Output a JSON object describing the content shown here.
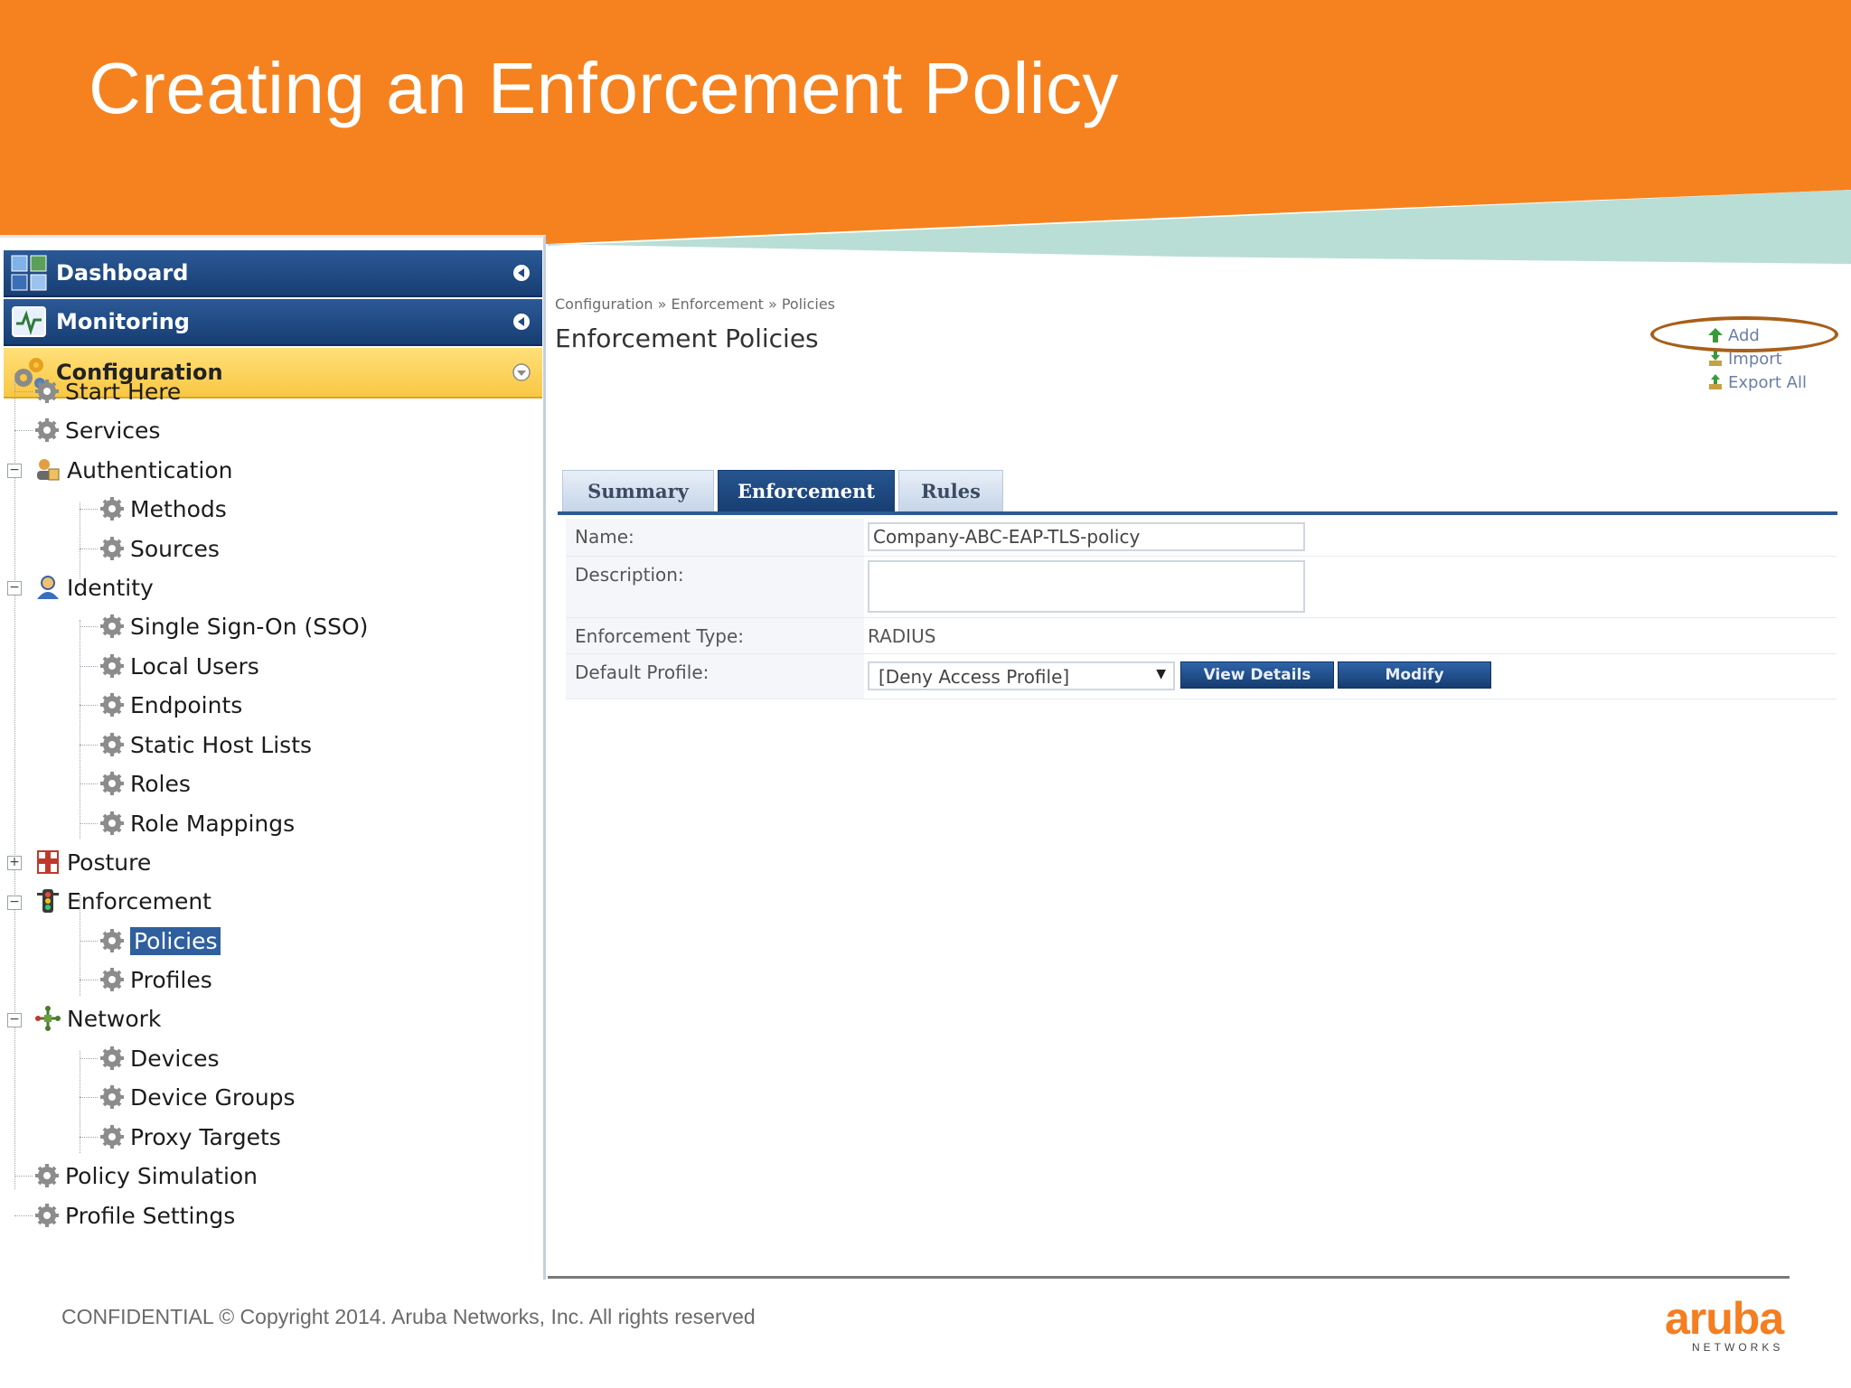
{
  "slide": {
    "title": "Creating an Enforcement Policy",
    "footer": "CONFIDENTIAL © Copyright 2014. Aruba Networks, Inc. All rights reserved",
    "logo": {
      "word": "aruba",
      "sub": "NETWORKS"
    },
    "colors": {
      "banner": "#f5821f",
      "teal": "#b9ded6",
      "nav_blue": "#1f4a84",
      "nav_active": "#f9c744",
      "logo": "#f47e20"
    }
  },
  "nav": {
    "dashboard": "Dashboard",
    "monitoring": "Monitoring",
    "configuration": "Configuration"
  },
  "tree": {
    "start_here": "Start Here",
    "services": "Services",
    "authentication": "Authentication",
    "methods": "Methods",
    "sources": "Sources",
    "identity": "Identity",
    "sso": "Single Sign-On (SSO)",
    "local_users": "Local Users",
    "endpoints": "Endpoints",
    "static_host_lists": "Static Host Lists",
    "roles": "Roles",
    "role_mappings": "Role Mappings",
    "posture": "Posture",
    "enforcement": "Enforcement",
    "policies": "Policies",
    "profiles": "Profiles",
    "network": "Network",
    "devices": "Devices",
    "device_groups": "Device Groups",
    "proxy_targets": "Proxy Targets",
    "policy_simulation": "Policy Simulation",
    "profile_settings": "Profile Settings",
    "expander_minus": "−",
    "expander_plus": "+"
  },
  "main": {
    "breadcrumb": "Configuration » Enforcement » Policies",
    "title": "Enforcement Policies",
    "actions": {
      "add": "Add",
      "import": "Import",
      "export_all": "Export All"
    },
    "tabs": {
      "summary": "Summary",
      "enforcement": "Enforcement",
      "rules": "Rules"
    },
    "form": {
      "name_label": "Name:",
      "name_value": "Company-ABC-EAP-TLS-policy",
      "description_label": "Description:",
      "type_label": "Enforcement Type:",
      "type_value": "RADIUS",
      "default_profile_label": "Default Profile:",
      "default_profile_value": "[Deny Access Profile]",
      "caret": "▼",
      "view_details": "View Details",
      "modify": "Modify"
    }
  }
}
